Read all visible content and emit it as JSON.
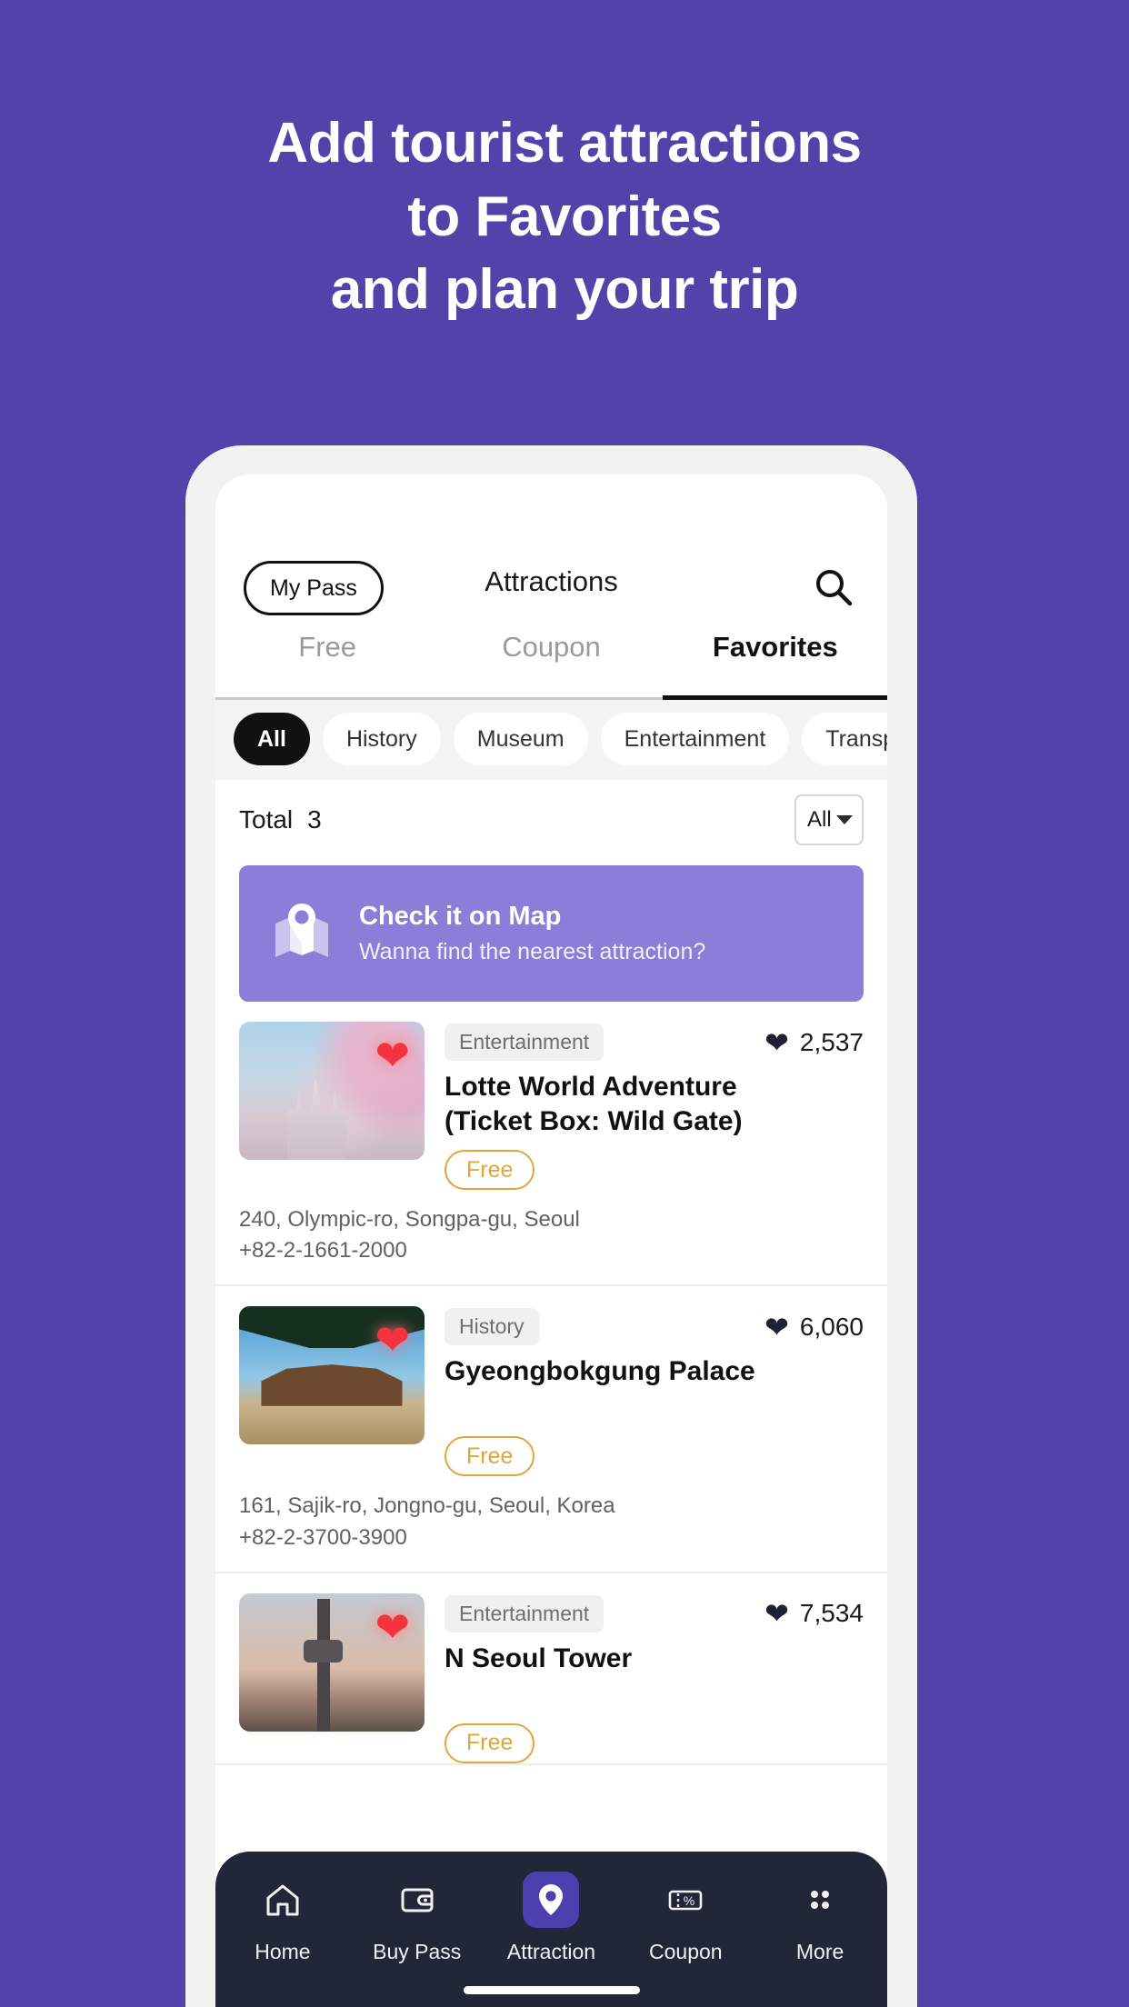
{
  "headline": {
    "line1": "Add tourist attractions",
    "line2": "to Favorites",
    "line3": "and plan your trip"
  },
  "colors": {
    "page_background": "#5243AB",
    "phone_frame": "#F2F2F0",
    "banner_purple": "#8B7DD8",
    "nav_background": "#222639",
    "nav_active": "#4C3FB0",
    "free_pill": "#E2A53A",
    "heart_red": "#F5333F"
  },
  "app": {
    "header": {
      "my_pass_label": "My Pass",
      "title": "Attractions",
      "search_icon": "search-icon"
    },
    "tabs": [
      {
        "label": "Free",
        "active": false
      },
      {
        "label": "Coupon",
        "active": false
      },
      {
        "label": "Favorites",
        "active": true
      }
    ],
    "category_chips": [
      {
        "label": "All",
        "active": true
      },
      {
        "label": "History",
        "active": false
      },
      {
        "label": "Museum",
        "active": false
      },
      {
        "label": "Entertainment",
        "active": false
      },
      {
        "label": "Transport",
        "active": false
      }
    ],
    "total": {
      "label": "Total",
      "count": "3",
      "sort_value": "All"
    },
    "map_banner": {
      "icon": "map-pin-icon",
      "title": "Check it on Map",
      "subtitle": "Wanna find the nearest attraction?"
    },
    "attractions": [
      {
        "category": "Entertainment",
        "likes": "2,537",
        "title": "Lotte World Adventure\n(Ticket Box: Wild Gate)",
        "title_line1": "Lotte World Adventure",
        "title_line2": "(Ticket Box: Wild Gate)",
        "badge": "Free",
        "address": "240, Olympic-ro, Songpa-gu, Seoul",
        "phone": "+82-2-1661-2000",
        "favorited": true
      },
      {
        "category": "History",
        "likes": "6,060",
        "title_line1": "Gyeongbokgung Palace",
        "title_line2": "",
        "badge": "Free",
        "address": "161, Sajik-ro, Jongno-gu, Seoul, Korea",
        "phone": "+82-2-3700-3900",
        "favorited": true
      },
      {
        "category": "Entertainment",
        "likes": "7,534",
        "title_line1": "N Seoul Tower",
        "title_line2": "",
        "badge": "Free",
        "address": "",
        "phone": "",
        "favorited": true
      }
    ],
    "bottom_nav": [
      {
        "label": "Home",
        "icon": "home-icon",
        "active": false
      },
      {
        "label": "Buy Pass",
        "icon": "wallet-icon",
        "active": false
      },
      {
        "label": "Attraction",
        "icon": "map-pin-icon",
        "active": true
      },
      {
        "label": "Coupon",
        "icon": "ticket-percent-icon",
        "active": false
      },
      {
        "label": "More",
        "icon": "grid-dots-icon",
        "active": false
      }
    ]
  }
}
